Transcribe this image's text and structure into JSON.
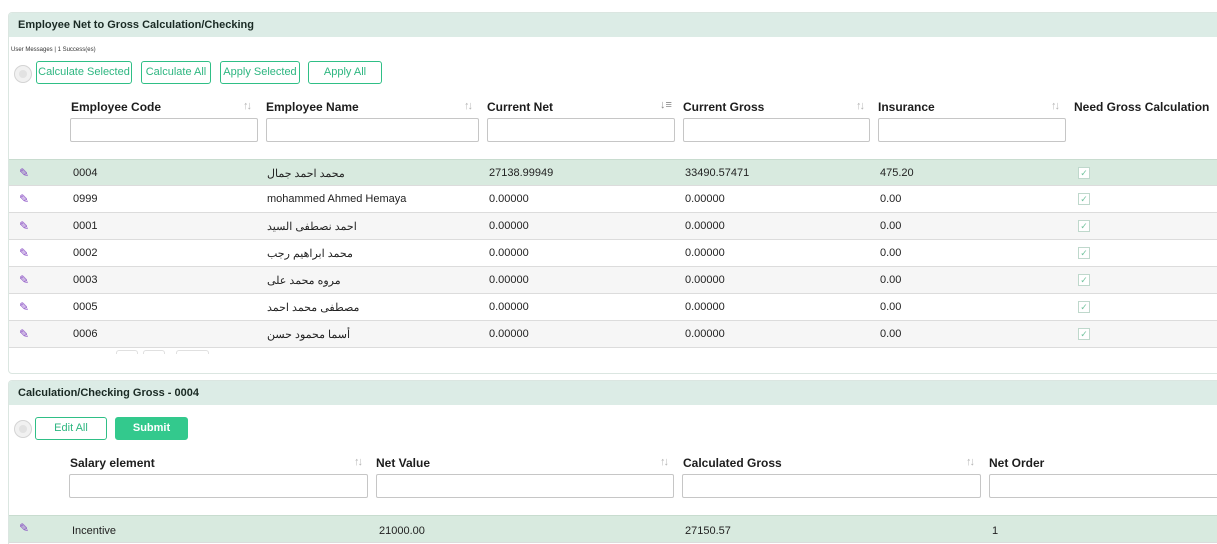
{
  "panel1": {
    "title": "Employee Net to Gross Calculation/Checking",
    "user_messages": "User Messages | 1 Success(es)",
    "buttons": {
      "calculate_selected": "Calculate Selected",
      "calculate_all": "Calculate All",
      "apply_selected": "Apply Selected",
      "apply_all": "Apply All"
    },
    "columns": {
      "code": "Employee Code",
      "name": "Employee Name",
      "net": "Current Net",
      "gross": "Current Gross",
      "insurance": "Insurance",
      "need": "Need Gross Calculation"
    },
    "rows": [
      {
        "code": "0004",
        "name": "محمد احمد جمال",
        "net": "27138.99949",
        "gross": "33490.57471",
        "insurance": "475.20",
        "need": true
      },
      {
        "code": "0999",
        "name": "mohammed Ahmed Hemaya",
        "net": "0.00000",
        "gross": "0.00000",
        "insurance": "0.00",
        "need": true
      },
      {
        "code": "0001",
        "name": "احمد نصطفى السيد",
        "net": "0.00000",
        "gross": "0.00000",
        "insurance": "0.00",
        "need": true
      },
      {
        "code": "0002",
        "name": "محمد ابراهيم رجب",
        "net": "0.00000",
        "gross": "0.00000",
        "insurance": "0.00",
        "need": true
      },
      {
        "code": "0003",
        "name": "مروه محمد على",
        "net": "0.00000",
        "gross": "0.00000",
        "insurance": "0.00",
        "need": true
      },
      {
        "code": "0005",
        "name": "مصطفى محمد احمد",
        "net": "0.00000",
        "gross": "0.00000",
        "insurance": "0.00",
        "need": true
      },
      {
        "code": "0006",
        "name": "أسما محمود حسن",
        "net": "0.00000",
        "gross": "0.00000",
        "insurance": "0.00",
        "need": true
      }
    ]
  },
  "panel2": {
    "title": "Calculation/Checking Gross - 0004",
    "buttons": {
      "edit_all": "Edit All",
      "submit": "Submit"
    },
    "columns": {
      "element": "Salary element",
      "net_value": "Net Value",
      "calc_gross": "Calculated Gross",
      "net_order": "Net Order"
    },
    "rows": [
      {
        "element": "Incentive",
        "net_value": "21000.00",
        "calc_gross": "27150.57",
        "net_order": "1"
      }
    ]
  },
  "colors": {
    "accent": "#33c98d",
    "header_bg": "#dcece6",
    "selected_row": "#d8eadf",
    "edit_icon": "#7f3fbf"
  },
  "icons": {
    "edit": "pencil-icon",
    "sort": "sort-icon",
    "sort_desc": "sort-descending-icon",
    "check": "checkbox-checked-icon"
  }
}
